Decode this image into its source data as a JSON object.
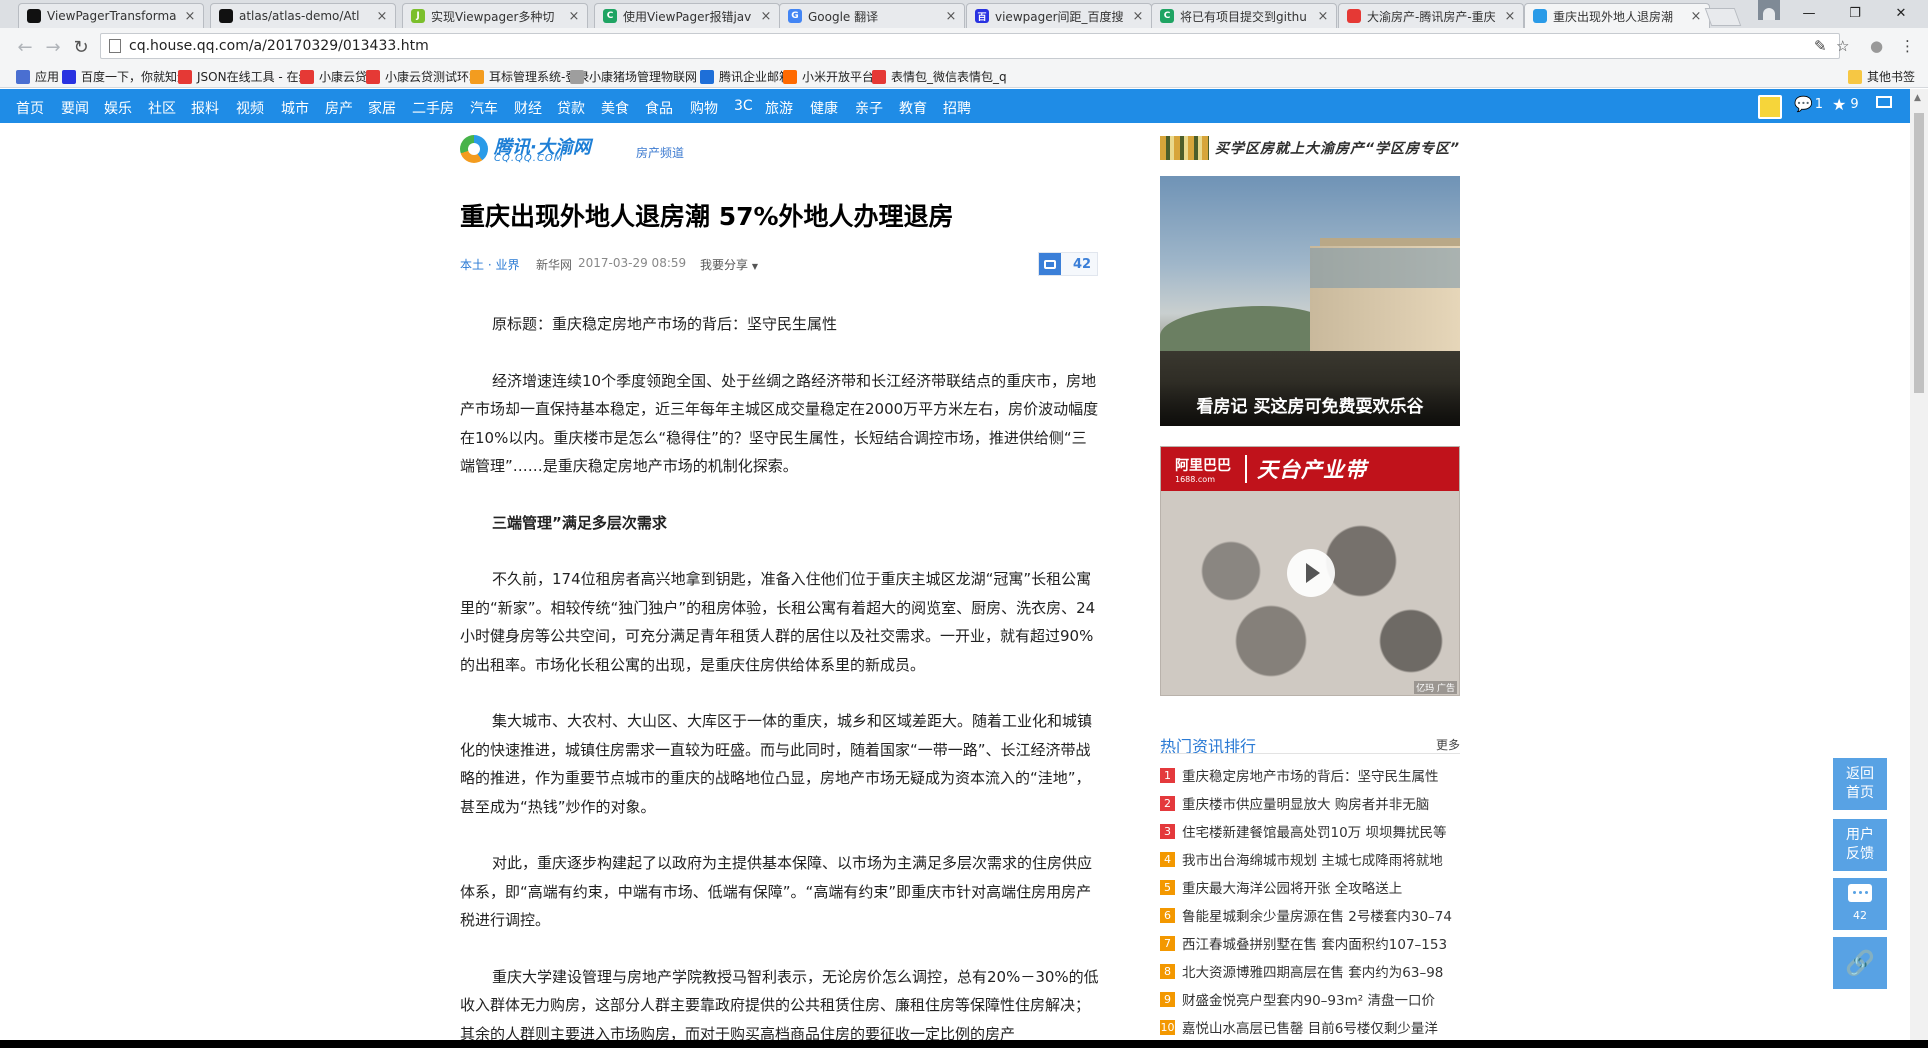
{
  "browser": {
    "tabs": [
      {
        "title": "ViewPagerTransforma",
        "fav_color": "#111111",
        "fav_glyph": "",
        "active": false
      },
      {
        "title": "atlas/atlas-demo/Atl",
        "fav_color": "#111111",
        "fav_glyph": "",
        "active": false
      },
      {
        "title": "实现Viewpager多种切",
        "fav_color": "#7bbf2c",
        "fav_glyph": "J",
        "active": false
      },
      {
        "title": "使用ViewPager报错jav",
        "fav_color": "#1fa463",
        "fav_glyph": "C",
        "active": false
      },
      {
        "title": "Google 翻译",
        "fav_color": "#4285f4",
        "fav_glyph": "G",
        "active": false
      },
      {
        "title": "viewpager间距_百度搜",
        "fav_color": "#2932e1",
        "fav_glyph": "百",
        "active": false
      },
      {
        "title": "将已有项目提交到githu",
        "fav_color": "#1fa463",
        "fav_glyph": "C",
        "active": false
      },
      {
        "title": "大渝房产-腾讯房产-重庆",
        "fav_color": "#e53935",
        "fav_glyph": "",
        "active": false
      },
      {
        "title": "重庆出现外地人退房潮",
        "fav_color": "#2a9be8",
        "fav_glyph": "",
        "active": true
      }
    ],
    "url": "cq.house.qq.com/a/20170329/013433.htm",
    "bookmarks": [
      {
        "label": "应用",
        "color": "#4a6fd1"
      },
      {
        "label": "百度一下，你就知道",
        "color": "#2932e1"
      },
      {
        "label": "JSON在线工具 - 在线",
        "color": "#e53935"
      },
      {
        "label": "小康云贷",
        "color": "#e53935"
      },
      {
        "label": "小康云贷测试环境",
        "color": "#e53935"
      },
      {
        "label": "耳标管理系统-登录",
        "color": "#f39c1f"
      },
      {
        "label": "小康猪场管理物联网",
        "color": "#9e9e9e"
      },
      {
        "label": "腾讯企业邮箱",
        "color": "#1e6fd8"
      },
      {
        "label": "小米开放平台",
        "color": "#ff6a00"
      },
      {
        "label": "表情包_微信表情包_q",
        "color": "#e53935"
      },
      {
        "label": "其他书签",
        "color": "#f6c744"
      }
    ]
  },
  "site_nav": {
    "items": [
      "首页",
      "要闻",
      "娱乐",
      "社区",
      "报料",
      "视频",
      "城市",
      "房产",
      "家居",
      "二手房",
      "汽车",
      "财经",
      "贷款",
      "美食",
      "食品",
      "购物",
      "3C",
      "旅游",
      "健康",
      "亲子",
      "教育",
      "招聘"
    ],
    "messages_count": "1",
    "favorites_count": "9"
  },
  "header": {
    "brand": "腾讯·大渝网",
    "domain": "CQ.QQ.COM",
    "channel": "房产频道"
  },
  "article": {
    "title": "重庆出现外地人退房潮 57%外地人办理退房",
    "category": "本土 · 业界",
    "source": "新华网",
    "datetime": "2017-03-29  08:59",
    "share": "我要分享",
    "comment_count": "42",
    "paragraphs": [
      {
        "text": "原标题：重庆稳定房地产市场的背后：坚守民生属性",
        "heading": false
      },
      {
        "text": "经济增速连续10个季度领跑全国、处于丝绸之路经济带和长江经济带联结点的重庆市，房地产市场却一直保持基本稳定，近三年每年主城区成交量稳定在2000万平方米左右，房价波动幅度在10%以内。重庆楼市是怎么“稳得住”的？坚守民生属性，长短结合调控市场，推进供给侧“三端管理”……是重庆稳定房地产市场的机制化探索。",
        "heading": false
      },
      {
        "text": "三端管理”满足多层次需求",
        "heading": true
      },
      {
        "text": "不久前，174位租房者高兴地拿到钥匙，准备入住他们位于重庆主城区龙湖“冠寓”长租公寓里的“新家”。相较传统“独门独户”的租房体验，长租公寓有着超大的阅览室、厨房、洗衣房、24小时健身房等公共空间，可充分满足青年租赁人群的居住以及社交需求。一开业，就有超过90%的出租率。市场化长租公寓的出现，是重庆住房供给体系里的新成员。",
        "heading": false
      },
      {
        "text": "集大城市、大农村、大山区、大库区于一体的重庆，城乡和区域差距大。随着工业化和城镇化的快速推进，城镇住房需求一直较为旺盛。而与此同时，随着国家“一带一路”、长江经济带战略的推进，作为重要节点城市的重庆的战略地位凸显，房地产市场无疑成为资本流入的“洼地”，甚至成为“热钱”炒作的对象。",
        "heading": false
      },
      {
        "text": "对此，重庆逐步构建起了以政府为主提供基本保障、以市场为主满足多层次需求的住房供应体系，即“高端有约束，中端有市场、低端有保障”。“高端有约束”即重庆市针对高端住房用房产税进行调控。",
        "heading": false
      },
      {
        "text": "重庆大学建设管理与房地产学院教授马智利表示，无论房价怎么调控，总有20%－30%的低收入群体无力购房，这部分人群主要靠政府提供的公共租赁住房、廉租住房等保障性住房解决；其余的人群则主要进入市场购房，而对于购买高档商品住房的要征收一定比例的房产",
        "heading": false
      }
    ]
  },
  "sidebar": {
    "banner_text": "买学区房就上大渝房产“学区房专区”",
    "photo_caption": "看房记 买这房可免费耍欢乐谷",
    "video_ad": {
      "brand": "阿里巴巴",
      "brand_domain": "1688.com",
      "title": "天台产业带",
      "ad_tag": "亿玛 广告"
    },
    "hot_news_title": "热门资讯排行",
    "hot_news_more": "更多",
    "hot_news": [
      {
        "rank": "1",
        "text": "重庆稳定房地产市场的背后：坚守民生属性",
        "top": true
      },
      {
        "rank": "2",
        "text": "重庆楼市供应量明显放大 购房者并非无脑",
        "top": true
      },
      {
        "rank": "3",
        "text": "住宅楼新建餐馆最高处罚10万 坝坝舞扰民等",
        "top": true
      },
      {
        "rank": "4",
        "text": "我市出台海绵城市规划 主城七成降雨将就地",
        "top": false
      },
      {
        "rank": "5",
        "text": "重庆最大海洋公园将开张 全攻略送上",
        "top": false
      },
      {
        "rank": "6",
        "text": "鲁能星城剩余少量房源在售  2号楼套内30–74",
        "top": false
      },
      {
        "rank": "7",
        "text": "西江春城叠拼别墅在售  套内面积约107–153",
        "top": false
      },
      {
        "rank": "8",
        "text": "北大资源博雅四期高层在售  套内约为63–98",
        "top": false
      },
      {
        "rank": "9",
        "text": "财盛金悦亮户型套内90–93m²  清盘一口价",
        "top": false
      },
      {
        "rank": "10",
        "text": "嘉悦山水高层已售罄  目前6号楼仅剩少量洋",
        "top": false
      }
    ]
  },
  "float_buttons": {
    "back_home": "返回首页",
    "feedback": "用户反馈",
    "comments": "42"
  },
  "colors": {
    "site_blue": "#1f8ce6",
    "link_blue": "#2a7ad4",
    "hot_rank_top": "#e4393c",
    "hot_rank_other": "#f39800",
    "float_button": "#58a2e4"
  }
}
